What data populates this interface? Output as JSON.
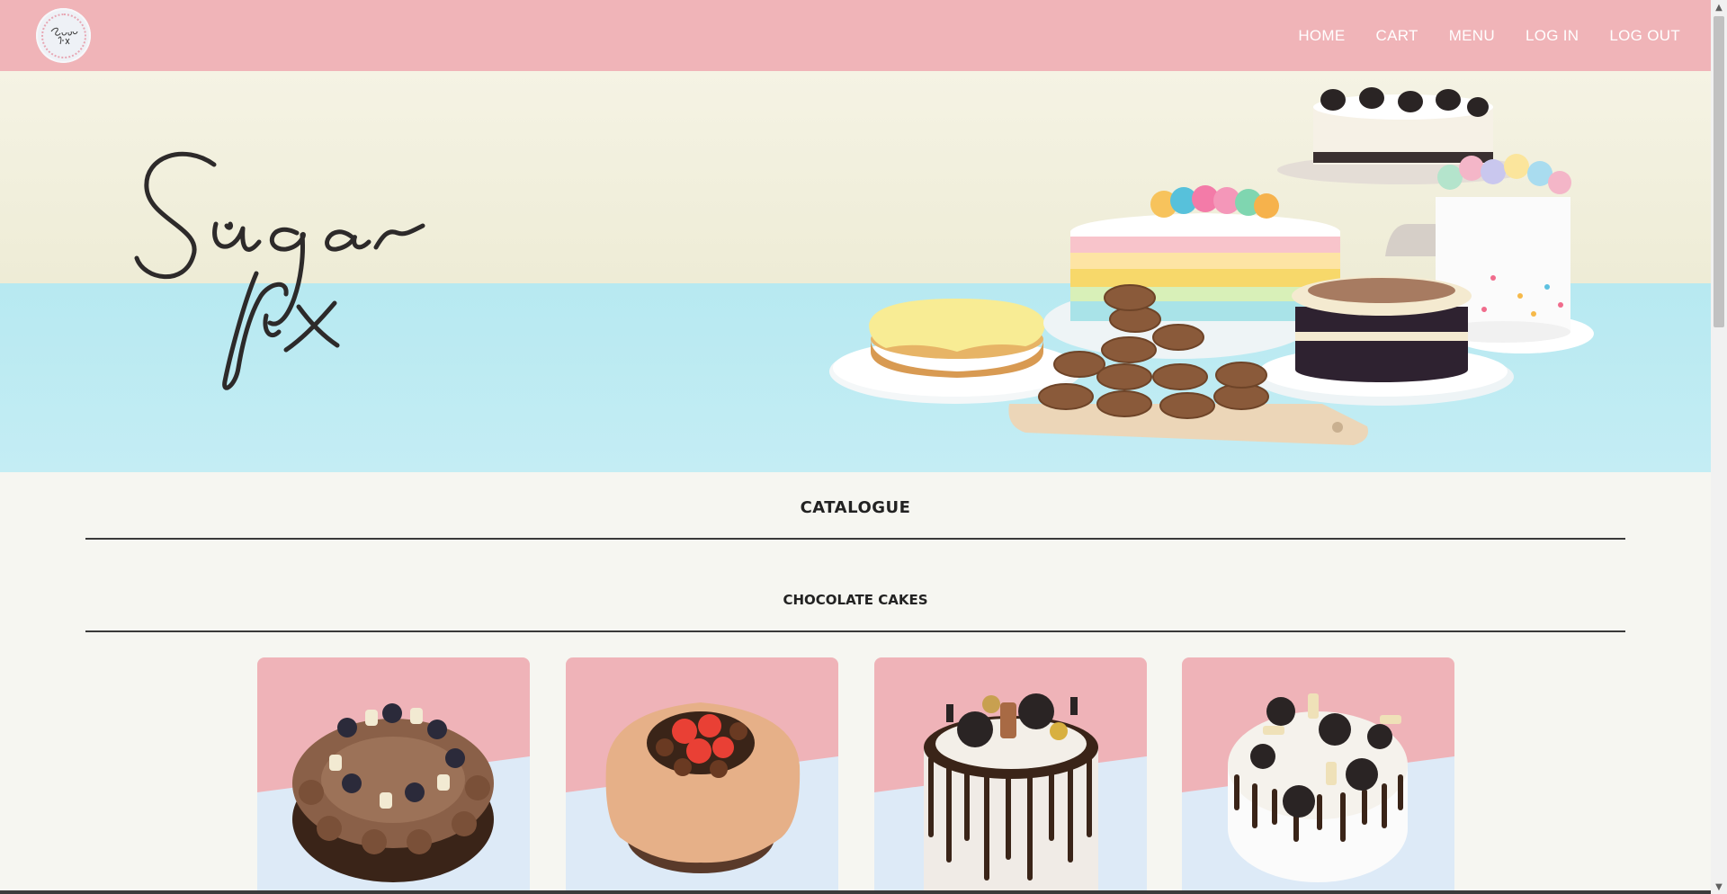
{
  "nav": {
    "logo_text": "Sugar fix",
    "links": [
      "HOME",
      "CART",
      "MENU",
      "LOG IN",
      "LOG OUT"
    ]
  },
  "hero": {
    "script_line1": "Sugar",
    "script_line2": "fix"
  },
  "catalogue": {
    "title": "CATALOGUE",
    "category": "CHOCOLATE CAKES"
  },
  "colors": {
    "nav_bg": "#f0b4b8",
    "page_bg": "#f6f6f1",
    "hero_wall": "#f3f1df",
    "hero_table": "#bdebf2",
    "card_top": "#efb3b8",
    "card_bottom": "#ddeaf7"
  },
  "icons": {
    "scroll_up": "▲",
    "scroll_down": "▼"
  }
}
